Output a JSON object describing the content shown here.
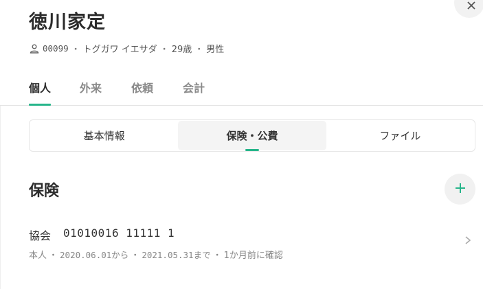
{
  "patient": {
    "name": "徳川家定",
    "id": "00099",
    "kana": "トグガワ イエサダ",
    "age": "29歳",
    "sex": "男性",
    "separator": "・"
  },
  "tabs": [
    {
      "label": "個人",
      "active": true
    },
    {
      "label": "外来",
      "active": false
    },
    {
      "label": "依頼",
      "active": false
    },
    {
      "label": "会計",
      "active": false
    }
  ],
  "segments": [
    {
      "label": "基本情報",
      "active": false
    },
    {
      "label": "保険・公費",
      "active": true
    },
    {
      "label": "ファイル",
      "active": false
    }
  ],
  "section": {
    "title": "保険"
  },
  "insurance": {
    "type": "協会",
    "number": "01010016 11111 1",
    "holder": "本人",
    "start": "2020.06.01から",
    "end": "2021.05.31まで",
    "note": "1か月前に確認"
  },
  "icons": {
    "close": "close-icon",
    "person": "person-icon",
    "add": "plus-icon",
    "chevron": "chevron-right-icon"
  },
  "colors": {
    "accent": "#26b58a"
  }
}
